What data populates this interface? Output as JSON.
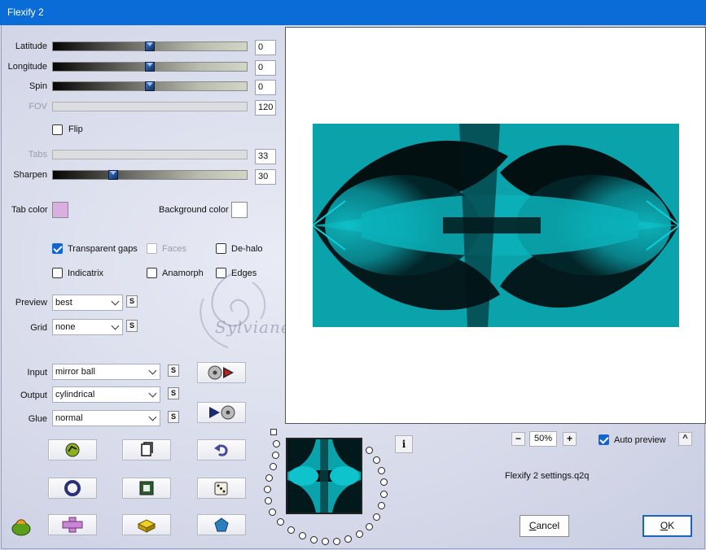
{
  "window": {
    "title": "Flexify 2"
  },
  "sliders": [
    {
      "label": "Latitude",
      "value": "0",
      "enabled": true
    },
    {
      "label": "Longitude",
      "value": "0",
      "enabled": true
    },
    {
      "label": "Spin",
      "value": "0",
      "enabled": true
    },
    {
      "label": "FOV",
      "value": "120",
      "enabled": false
    },
    {
      "label": "Tabs",
      "value": "33",
      "enabled": false
    },
    {
      "label": "Sharpen",
      "value": "30",
      "enabled": true
    }
  ],
  "flip": {
    "label": "Flip",
    "checked": false
  },
  "colors": {
    "tab_color_label": "Tab color",
    "tab_color": "#d9aee0",
    "background_color_label": "Background color",
    "background_color": "#ffffff"
  },
  "options": [
    {
      "label": "Transparent gaps",
      "checked": true,
      "enabled": true
    },
    {
      "label": "Faces",
      "checked": false,
      "enabled": false
    },
    {
      "label": "De-halo",
      "checked": false,
      "enabled": true
    },
    {
      "label": "Indicatrix",
      "checked": false,
      "enabled": true
    },
    {
      "label": "Anamorph",
      "checked": false,
      "enabled": true
    },
    {
      "label": "Edges",
      "checked": false,
      "enabled": true
    }
  ],
  "preview_setting": {
    "label": "Preview",
    "value": "best"
  },
  "grid_setting": {
    "label": "Grid",
    "value": "none"
  },
  "projection": {
    "input_label": "Input",
    "input_value": "mirror ball",
    "output_label": "Output",
    "output_value": "cylindrical",
    "glue_label": "Glue",
    "glue_value": "normal"
  },
  "small_button_label": "S",
  "watermark": "Sylviane",
  "zoom": {
    "minus": "−",
    "value": "50%",
    "plus": "+"
  },
  "auto_preview": {
    "label": "Auto preview",
    "checked": true
  },
  "collapse_label": "^",
  "info_label": "i",
  "settings_file": "Flexify 2 settings.q2q",
  "buttons": {
    "cancel": "Cancel",
    "ok": "OK"
  },
  "accent_colors": {
    "teal": "#0aa3ab",
    "title_bar": "#0a6cd6"
  },
  "icons": [
    "randomize-icon",
    "new-icon",
    "undo-icon",
    "circle-icon",
    "frame-icon",
    "dice-icon",
    "app-logo-icon",
    "cross-icon",
    "brick-icon",
    "gem-icon",
    "load-to-input-icon",
    "output-to-disc-icon",
    "info-icon"
  ]
}
